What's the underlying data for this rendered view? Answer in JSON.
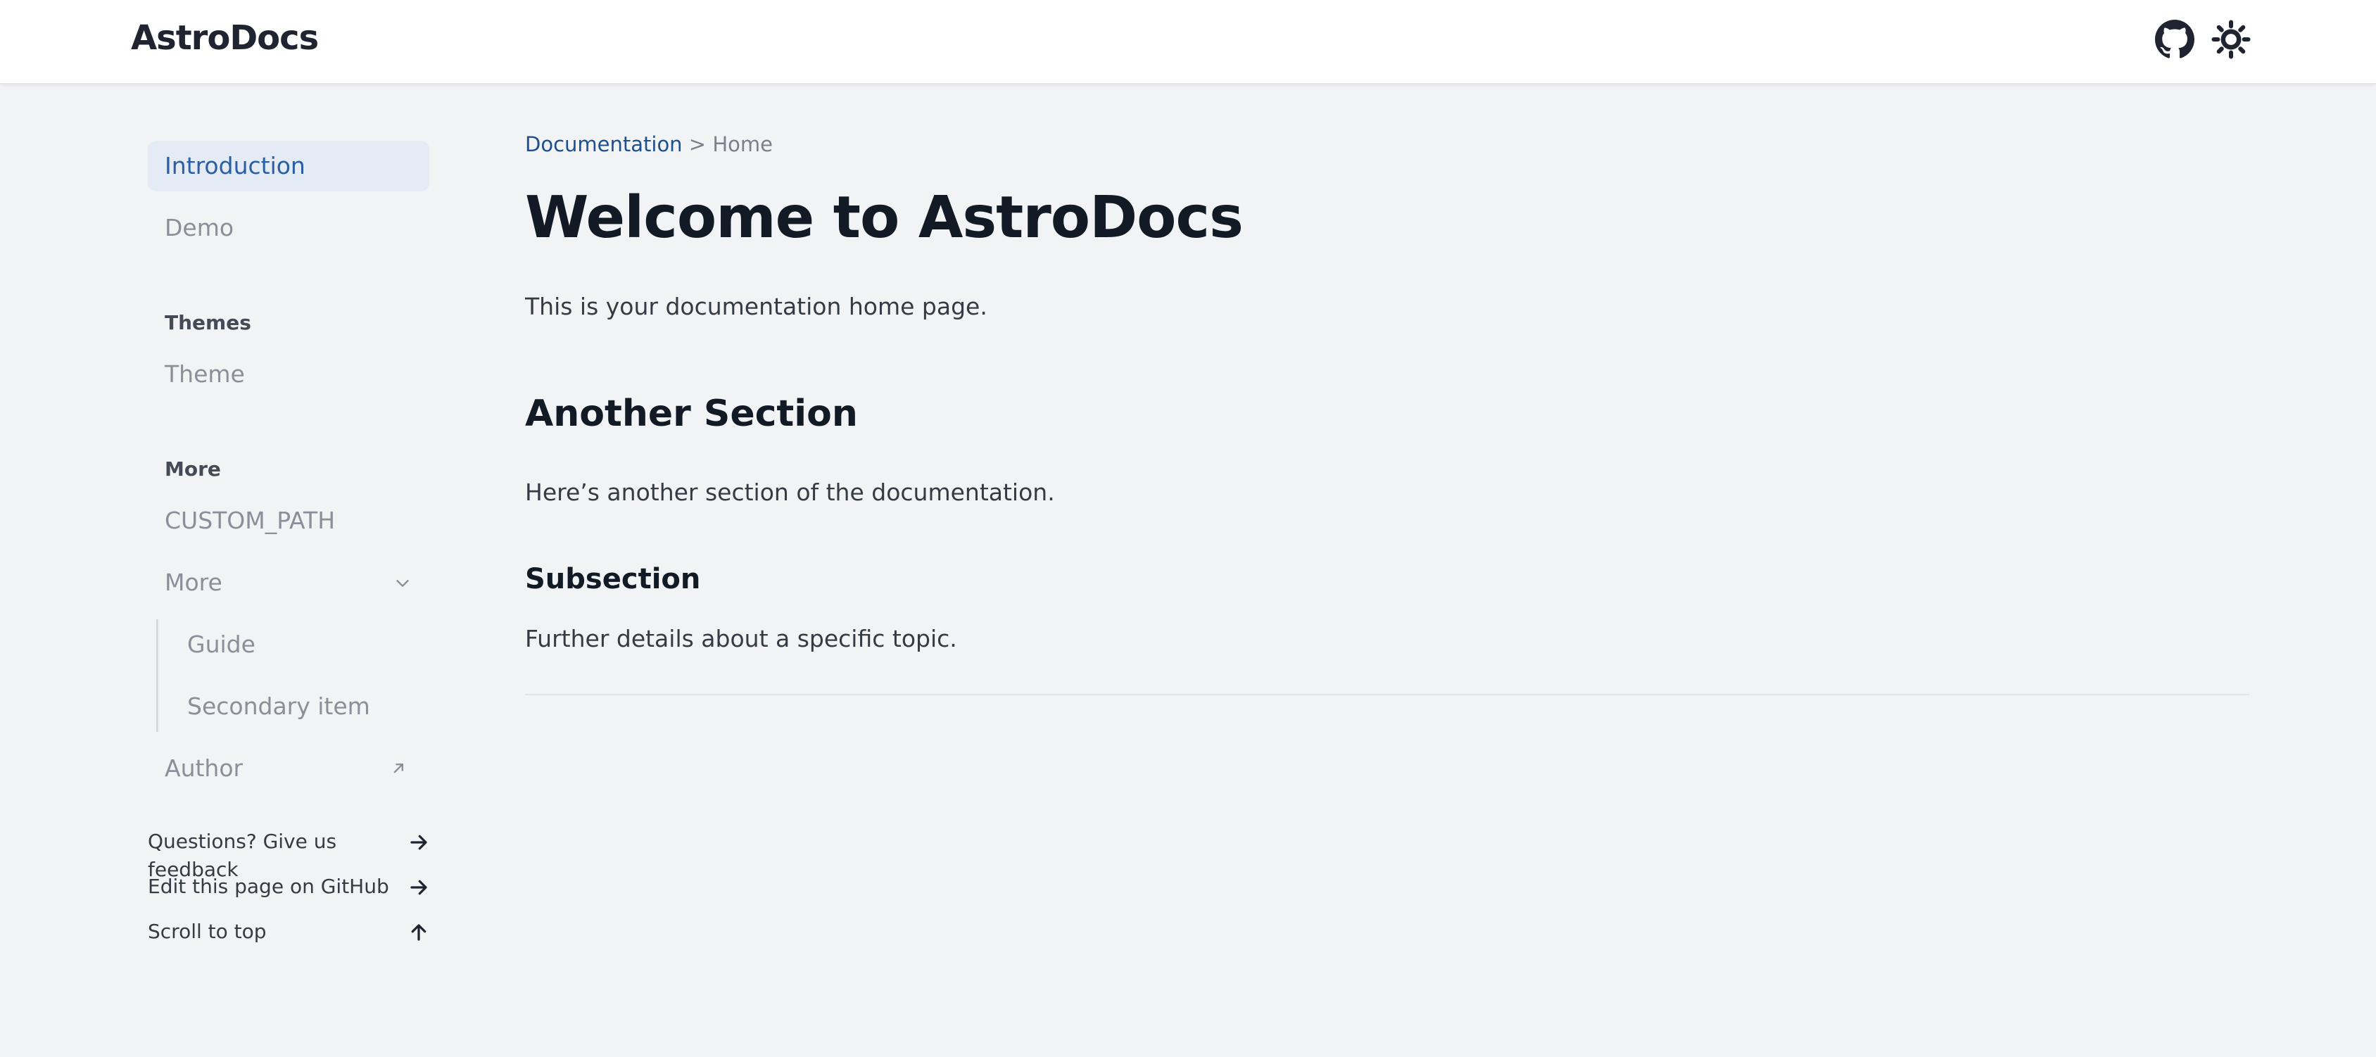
{
  "header": {
    "brand": "AstroDocs",
    "icons": [
      "github-icon",
      "sun-icon"
    ]
  },
  "sidebar": {
    "items": [
      {
        "label": "Introduction",
        "active": true
      },
      {
        "label": "Demo"
      }
    ],
    "groups": [
      {
        "title": "Themes",
        "items": [
          {
            "label": "Theme"
          }
        ]
      },
      {
        "title": "More",
        "items": [
          {
            "label": "CUSTOM_PATH"
          },
          {
            "label": "More",
            "expanded": true,
            "children": [
              {
                "label": "Guide"
              },
              {
                "label": "Secondary item"
              }
            ]
          },
          {
            "label": "Author",
            "external": true
          }
        ]
      }
    ],
    "footer_links": [
      {
        "label": "Questions? Give us feedback",
        "icon": "arrow-right-icon"
      },
      {
        "label": "Edit this page on GitHub",
        "icon": "arrow-right-icon"
      },
      {
        "label": "Scroll to top",
        "icon": "arrow-up-icon"
      }
    ]
  },
  "main": {
    "breadcrumb": {
      "link": "Documentation",
      "separator": ">",
      "current": "Home"
    },
    "title": "Welcome to AstroDocs",
    "intro": "This is your documentation home page.",
    "section_title": "Another Section",
    "section_text": "Here’s another section of the documentation.",
    "subsection_title": "Subsection",
    "subsection_text": "Further details about a specific topic."
  },
  "colors": {
    "background": "#f2f3f5",
    "header_bg": "#ffffff",
    "active_bg": "#e4ebf5",
    "active_text": "#2a5ea6",
    "link": "#1d4f91",
    "heading": "#121a26"
  }
}
